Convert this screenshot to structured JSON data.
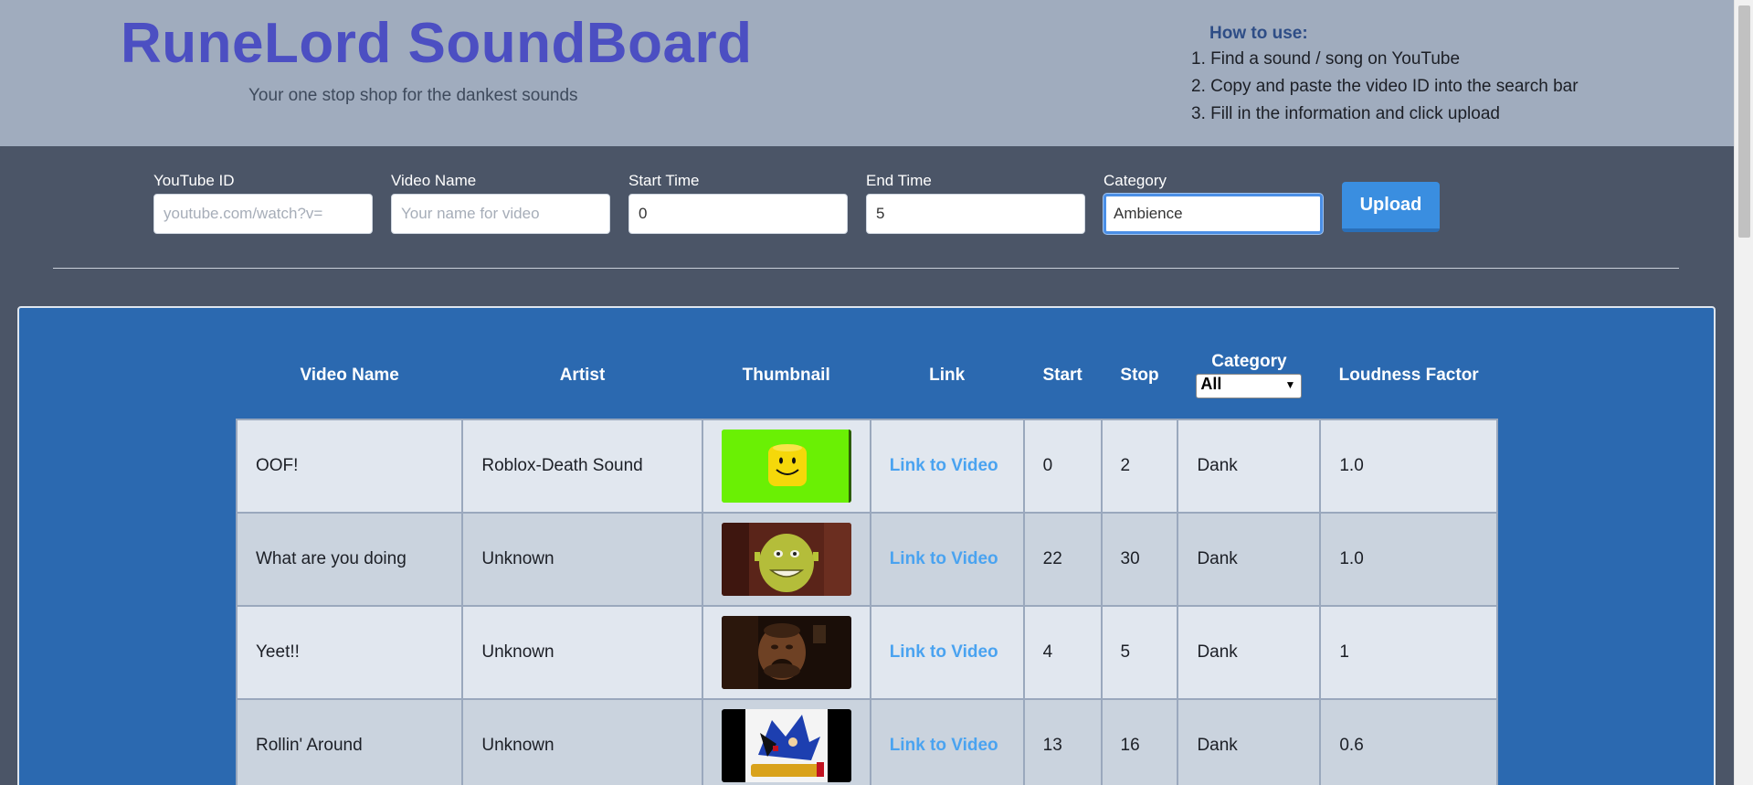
{
  "header": {
    "title": "RuneLord SoundBoard",
    "subtitle": "Your one stop shop for the dankest sounds",
    "howto_title": "How to use:",
    "howto_steps": [
      "1. Find a sound / song on YouTube",
      "2. Copy and paste the video ID into the search bar",
      "3. Fill in the information and click upload"
    ]
  },
  "form": {
    "youtube_id": {
      "label": "YouTube ID",
      "value": "",
      "placeholder": "youtube.com/watch?v="
    },
    "video_name": {
      "label": "Video Name",
      "value": "",
      "placeholder": "Your name for video"
    },
    "start_time": {
      "label": "Start Time",
      "value": "0",
      "placeholder": ""
    },
    "end_time": {
      "label": "End Time",
      "value": "5",
      "placeholder": ""
    },
    "category": {
      "label": "Category",
      "value": "Ambience",
      "placeholder": ""
    },
    "upload_label": "Upload"
  },
  "table": {
    "headers": {
      "video_name": "Video Name",
      "artist": "Artist",
      "thumbnail": "Thumbnail",
      "link": "Link",
      "start": "Start",
      "stop": "Stop",
      "category": "Category",
      "loudness": "Loudness Factor"
    },
    "category_filter": "All",
    "rows": [
      {
        "video_name": "OOF!",
        "artist": "Roblox-Death Sound",
        "thumbnail": "roblox-head-thumbnail",
        "link": "Link to Video",
        "start": "0",
        "stop": "2",
        "category": "Dank",
        "loudness": "1.0"
      },
      {
        "video_name": "What are you doing",
        "artist": "Unknown",
        "thumbnail": "shrek-face-thumbnail",
        "link": "Link to Video",
        "start": "22",
        "stop": "30",
        "category": "Dank",
        "loudness": "1.0"
      },
      {
        "video_name": "Yeet!!",
        "artist": "Unknown",
        "thumbnail": "man-face-thumbnail",
        "link": "Link to Video",
        "start": "4",
        "stop": "5",
        "category": "Dank",
        "loudness": "1"
      },
      {
        "video_name": "Rollin' Around",
        "artist": "Unknown",
        "thumbnail": "sonic-adventure-thumbnail",
        "link": "Link to Video",
        "start": "13",
        "stop": "16",
        "category": "Dank",
        "loudness": "0.6"
      }
    ]
  },
  "colors": {
    "header_bg": "#a0acbe",
    "title": "#4c4fc2",
    "form_bg": "#4b5567",
    "panel_bg": "#2b69b0",
    "link": "#4aa3f0",
    "upload": "#3a8ee0"
  }
}
